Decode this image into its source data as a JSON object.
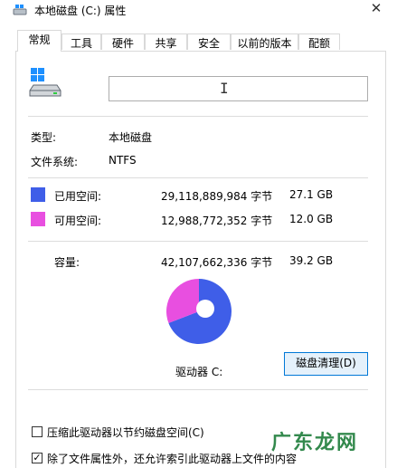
{
  "window": {
    "title": "本地磁盘 (C:) 属性",
    "close_glyph": "✕"
  },
  "tabs": [
    {
      "label": "常规",
      "active": true
    },
    {
      "label": "工具"
    },
    {
      "label": "硬件"
    },
    {
      "label": "共享"
    },
    {
      "label": "安全"
    },
    {
      "label": "以前的版本"
    },
    {
      "label": "配额"
    }
  ],
  "general": {
    "name_value": "",
    "type_label": "类型:",
    "type_value": "本地磁盘",
    "fs_label": "文件系统:",
    "fs_value": "NTFS",
    "used": {
      "label": "已用空间:",
      "bytes": "29,118,889,984 字节",
      "size": "27.1 GB",
      "color": "#3f5ee8"
    },
    "free": {
      "label": "可用空间:",
      "bytes": "12,988,772,352 字节",
      "size": "12.0 GB",
      "color": "#e84fe0"
    },
    "capacity": {
      "label": "容量:",
      "bytes": "42,107,662,336 字节",
      "size": "39.2 GB"
    },
    "drive_label": "驱动器 C:",
    "cleanup_button": "磁盘清理(D)",
    "compress_label": "压缩此驱动器以节约磁盘空间(C)",
    "compress_checked": false,
    "index_label": "除了文件属性外，还允许索引此驱动器上文件的内容",
    "index_checked": true
  },
  "chart_data": {
    "type": "pie",
    "categories": [
      "已用空间",
      "可用空间"
    ],
    "values": [
      29118889984,
      12988772352
    ],
    "colors": [
      "#3f5ee8",
      "#e84fe0"
    ]
  },
  "watermark": "广东龙网"
}
